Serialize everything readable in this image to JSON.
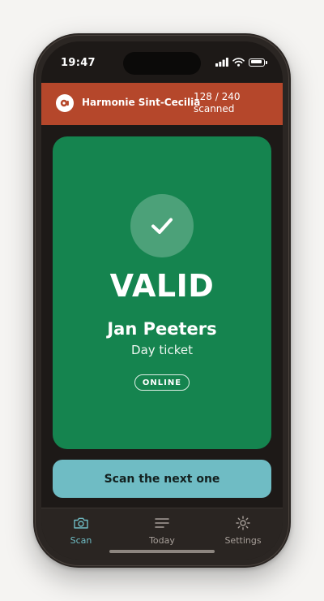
{
  "status_bar": {
    "time": "19:47"
  },
  "event": {
    "name": "Harmonie Sint-Cecilia",
    "scanned_count": "128 / 240\nscanned",
    "color": "#b5472b"
  },
  "result": {
    "status": "VALID",
    "holder_name": "Jan Peeters",
    "ticket_type": "Day ticket",
    "mode_badge": "ONLINE",
    "icon": "checkmark-icon",
    "color": "#15844f"
  },
  "actions": {
    "next_label": "Scan the next one",
    "color": "#6fbcc4"
  },
  "tabbar": {
    "tabs": [
      {
        "label": "Scan",
        "icon": "camera-icon",
        "active": true
      },
      {
        "label": "Today",
        "icon": "list-icon",
        "active": false
      },
      {
        "label": "Settings",
        "icon": "gear-icon",
        "active": false
      }
    ]
  }
}
